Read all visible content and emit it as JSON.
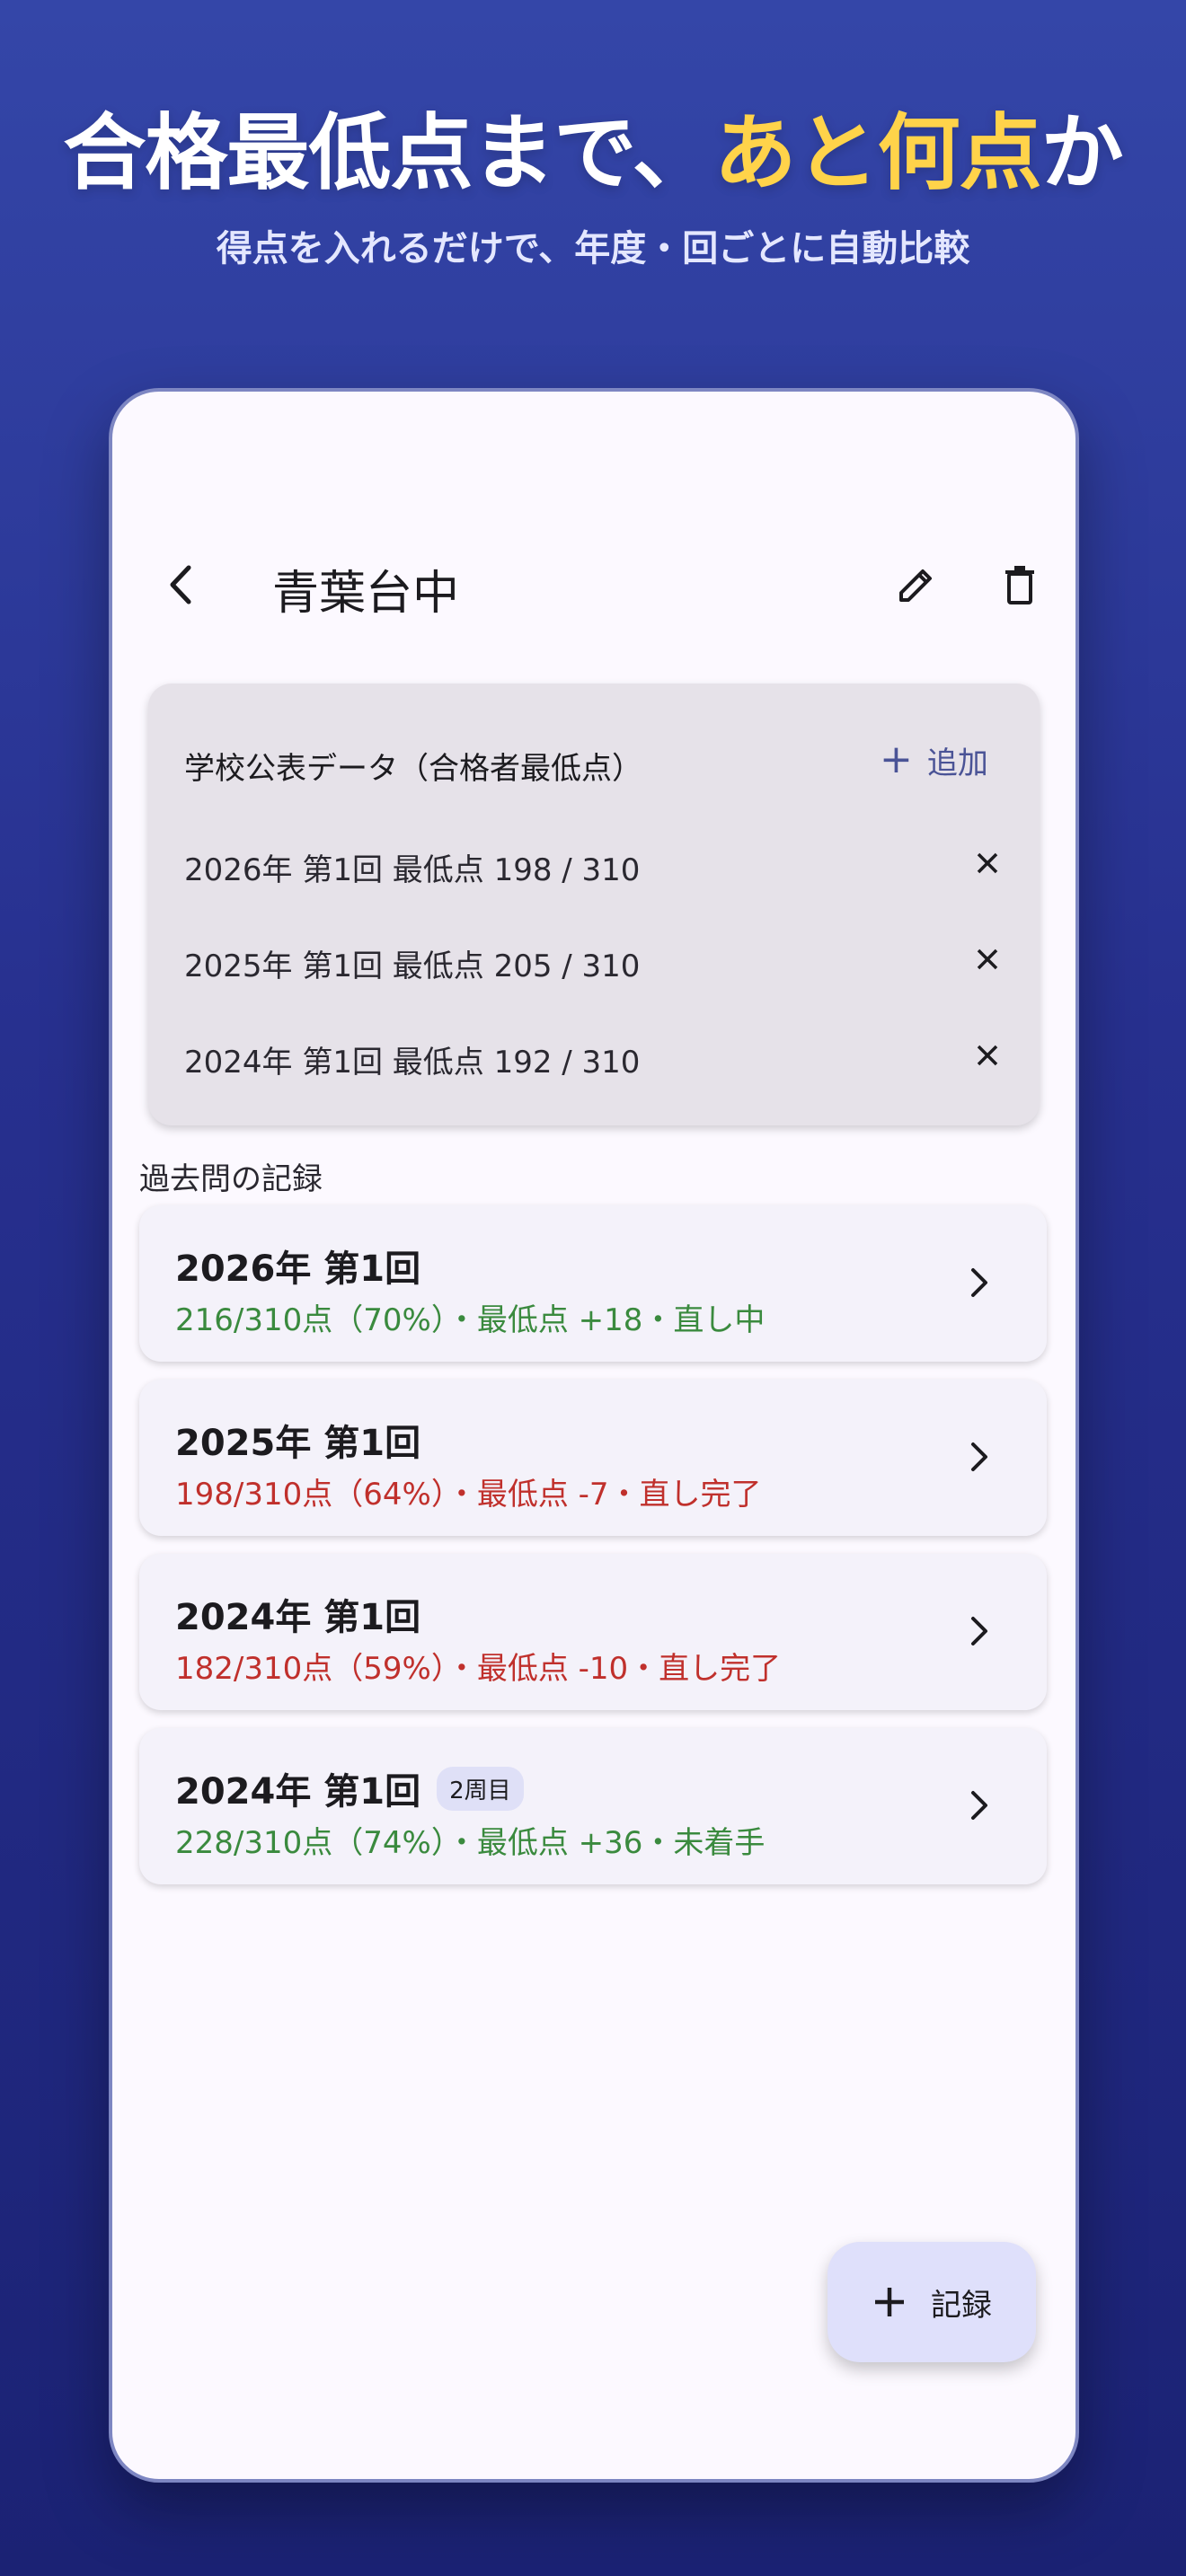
{
  "promo": {
    "headline_prefix": "合格最低点まで、",
    "headline_highlight": "あと何点",
    "headline_suffix": "か",
    "subheadline": "得点を入れるだけで、年度・回ごとに自動比較"
  },
  "appbar": {
    "title": "青葉台中",
    "back_icon": "back-arrow-icon",
    "edit_icon": "pencil-icon",
    "delete_icon": "trash-icon"
  },
  "public_data": {
    "title": "学校公表データ（合格者最低点）",
    "add_label": "追加",
    "rows": [
      {
        "text": "2026年 第1回  最低点 198 / 310"
      },
      {
        "text": "2025年 第1回  最低点 205 / 310"
      },
      {
        "text": "2024年 第1回  最低点 192 / 310"
      }
    ]
  },
  "records": {
    "section_label": "過去問の記録",
    "items": [
      {
        "title": "2026年 第1回",
        "badge": "",
        "summary": "216/310点（70%）・最低点 +18・直し中",
        "status": "good"
      },
      {
        "title": "2025年 第1回",
        "badge": "",
        "summary": "198/310点（64%）・最低点 -7・直し完了",
        "status": "bad"
      },
      {
        "title": "2024年 第1回",
        "badge": "",
        "summary": "182/310点（59%）・最低点 -10・直し完了",
        "status": "bad"
      },
      {
        "title": "2024年 第1回",
        "badge": "2周目",
        "summary": "228/310点（74%）・最低点 +36・未着手",
        "status": "good"
      }
    ]
  },
  "fab": {
    "label": "記録",
    "icon": "plus-icon"
  },
  "colors": {
    "background_top": "#3446a8",
    "background_bottom": "#1b2274",
    "highlight": "#ffd34a",
    "good": "#3a8a3e",
    "bad": "#c0302c",
    "accent": "#4a5396"
  }
}
